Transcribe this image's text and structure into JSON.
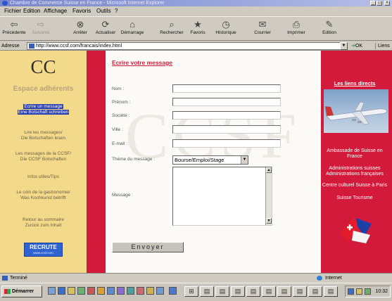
{
  "window": {
    "title": "Chambre de Commerce Suisse en France - Microsoft Internet Explorer",
    "min_glyph": "_",
    "max_glyph": "□",
    "close_glyph": "×"
  },
  "menu": [
    "Fichier",
    "Edition",
    "Affichage",
    "Favoris",
    "Outils",
    "?"
  ],
  "toolbar": [
    {
      "label": "Précédente",
      "icon": "back-arrow-icon",
      "glyph": "⇦",
      "disabled": false
    },
    {
      "label": "Suivante",
      "icon": "forward-arrow-icon",
      "glyph": "⇨",
      "disabled": true
    },
    {
      "label": "Arrêter",
      "icon": "stop-icon",
      "glyph": "⊗",
      "disabled": false
    },
    {
      "label": "Actualiser",
      "icon": "refresh-icon",
      "glyph": "⟳",
      "disabled": false
    },
    {
      "label": "Démarrage",
      "icon": "home-icon",
      "glyph": "⌂",
      "disabled": false
    },
    {
      "label": "Rechercher",
      "icon": "search-icon",
      "glyph": "⌕",
      "disabled": false
    },
    {
      "label": "Favoris",
      "icon": "favorites-icon",
      "glyph": "★",
      "disabled": false
    },
    {
      "label": "Historique",
      "icon": "history-icon",
      "glyph": "◷",
      "disabled": false
    },
    {
      "label": "Courrier",
      "icon": "mail-icon",
      "glyph": "✉",
      "disabled": false
    },
    {
      "label": "Imprimer",
      "icon": "printer-icon",
      "glyph": "⎙",
      "disabled": false
    },
    {
      "label": "Edition",
      "icon": "edit-icon",
      "glyph": "✎",
      "disabled": false
    }
  ],
  "address": {
    "label": "Adresse",
    "url": "http://www.ccsf.com/francais/index.html",
    "go_label": "OK",
    "links_label": "Liens"
  },
  "sidebar": {
    "logo": "CC",
    "section_title": "Espace adhérents",
    "items": [
      {
        "lines": [
          "Ecrire un message",
          "Eine Botschaft schreiben"
        ],
        "active": true
      },
      {
        "lines": [
          "Lire les messages/",
          "Die Botschaften lesen"
        ],
        "active": false
      },
      {
        "lines": [
          "Les messages de la CCSF/",
          "Die CCSF Botschaften"
        ],
        "active": false
      },
      {
        "lines": [
          "Infos utiles/Tips"
        ],
        "active": false
      },
      {
        "lines": [
          "Le coin de la gastronomie/",
          "Was Kochkunst betrifft"
        ],
        "active": false
      },
      {
        "lines": [
          "Retour au sommaire",
          "Zurück zum Inhalt"
        ],
        "active": false
      }
    ],
    "recruit_badge": {
      "label": "RECRUTE",
      "sub": "www.ccsf.com"
    }
  },
  "form": {
    "heading": "Ecrire votre message",
    "watermark": "CCSF",
    "fields": [
      {
        "label": "Nom :",
        "value": ""
      },
      {
        "label": "Prénom :",
        "value": ""
      },
      {
        "label": "Société :",
        "value": ""
      },
      {
        "label": "Ville :",
        "value": ""
      },
      {
        "label": "E-mail :",
        "value": ""
      }
    ],
    "theme_label": "Thème du message :",
    "theme_value": "Bourse/Emploi/Stage",
    "message_label": "Message :",
    "message_value": "",
    "submit_label": "Envoyer"
  },
  "rightbar": {
    "title": "Les liens directs",
    "links": [
      "Ambassade de Suisse en France",
      "Administrations suisses",
      "Administrations françaises",
      "Centre culturel Suisse à Paris",
      "Suisse Tourisme"
    ]
  },
  "status": {
    "left": "Terminé",
    "zone": "Internet"
  },
  "taskbar": {
    "start_label": "Démarrer",
    "clock": "10:32"
  },
  "colors": {
    "accent_red": "#d41a3a",
    "sidebar_yellow": "#f3d98a",
    "nav_active": "#2a3fb0",
    "recruit_blue": "#2f64d0"
  }
}
